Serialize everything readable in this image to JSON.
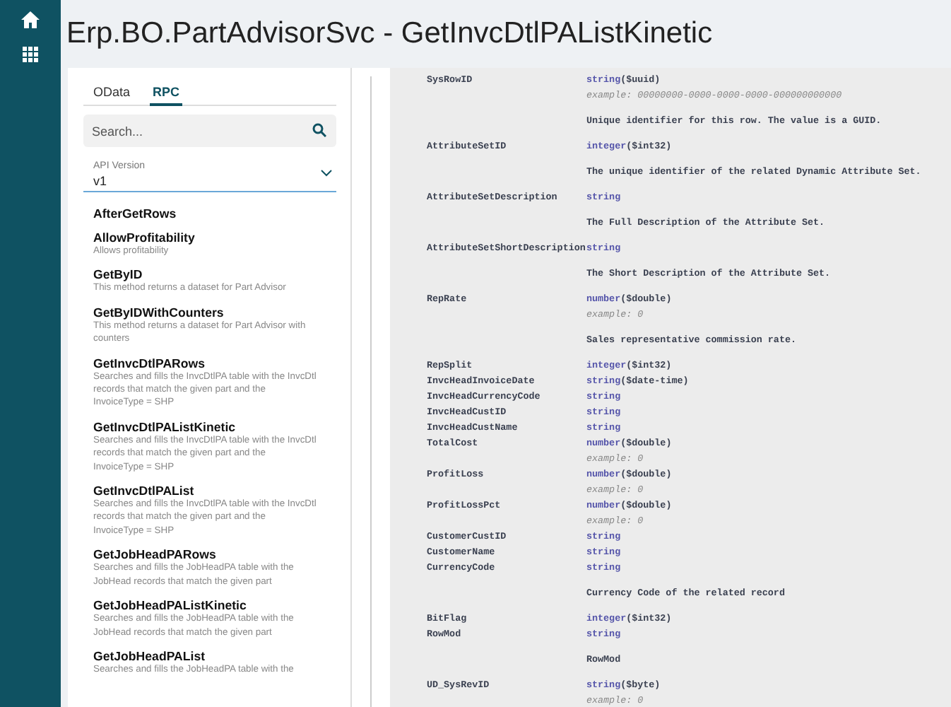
{
  "page_title": "Erp.BO.PartAdvisorSvc - GetInvcDtlPAListKinetic",
  "tabs": [
    {
      "label": "OData",
      "selected": false
    },
    {
      "label": "RPC",
      "selected": true
    }
  ],
  "search": {
    "placeholder": "Search..."
  },
  "api_version": {
    "label": "API Version",
    "value": "v1"
  },
  "methods": [
    {
      "name": "AfterGetRows"
    },
    {
      "name": "AllowProfitability",
      "description": "Allows profitability"
    },
    {
      "name": "GetByID",
      "description": "This method returns a dataset for Part Advisor"
    },
    {
      "name": "GetByIDWithCounters",
      "description": "This method returns a dataset for Part Advisor with counters"
    },
    {
      "name": "GetInvcDtlPARows",
      "description": "Searches and fills the InvcDtlPA table with the InvcDtl records that match the given part and the InvoiceType = SHP"
    },
    {
      "name": "GetInvcDtlPAListKinetic",
      "description": "Searches and fills the InvcDtlPA table with the InvcDtl records that match the given part and the InvoiceType = SHP"
    },
    {
      "name": "GetInvcDtlPAList",
      "description": "Searches and fills the InvcDtlPA table with the InvcDtl records that match the given part and the InvoiceType = SHP"
    },
    {
      "name": "GetJobHeadPARows",
      "description": "Searches and fills the JobHeadPA table with the JobHead records that match the given part"
    },
    {
      "name": "GetJobHeadPAListKinetic",
      "description": "Searches and fills the JobHeadPA table with the JobHead records that match the given part"
    },
    {
      "name": "GetJobHeadPAList",
      "description": "Searches and fills the JobHeadPA table with the"
    }
  ],
  "properties": [
    {
      "name": "SysRowID",
      "type": "string",
      "format": "($uuid)",
      "example": "example: 00000000-0000-0000-0000-000000000000",
      "description": "Unique identifier for this row. The value is a GUID."
    },
    {
      "name": "AttributeSetID",
      "type": "integer",
      "format": "($int32)",
      "description": "The unique identifier of the related Dynamic Attribute Set."
    },
    {
      "name": "AttributeSetDescription",
      "type": "string",
      "description": "The Full Description of the Attribute Set."
    },
    {
      "name": "AttributeSetShortDescription",
      "type": "string",
      "description": "The Short Description of the Attribute Set."
    },
    {
      "name": "RepRate",
      "type": "number",
      "format": "($double)",
      "example": "example: 0",
      "description": "Sales representative commission rate."
    },
    {
      "name": "RepSplit",
      "type": "integer",
      "format": "($int32)"
    },
    {
      "name": "InvcHeadInvoiceDate",
      "type": "string",
      "format": "($date-time)"
    },
    {
      "name": "InvcHeadCurrencyCode",
      "type": "string"
    },
    {
      "name": "InvcHeadCustID",
      "type": "string"
    },
    {
      "name": "InvcHeadCustName",
      "type": "string"
    },
    {
      "name": "TotalCost",
      "type": "number",
      "format": "($double)",
      "example": "example: 0"
    },
    {
      "name": "ProfitLoss",
      "type": "number",
      "format": "($double)",
      "example": "example: 0"
    },
    {
      "name": "ProfitLossPct",
      "type": "number",
      "format": "($double)",
      "example": "example: 0"
    },
    {
      "name": "CustomerCustID",
      "type": "string"
    },
    {
      "name": "CustomerName",
      "type": "string"
    },
    {
      "name": "CurrencyCode",
      "type": "string",
      "description": "Currency Code of the related record"
    },
    {
      "name": "BitFlag",
      "type": "integer",
      "format": "($int32)"
    },
    {
      "name": "RowMod",
      "type": "string",
      "description": "RowMod"
    },
    {
      "name": "UD_SysRevID",
      "type": "string",
      "format": "($byte)",
      "example": "example: 0"
    }
  ]
}
